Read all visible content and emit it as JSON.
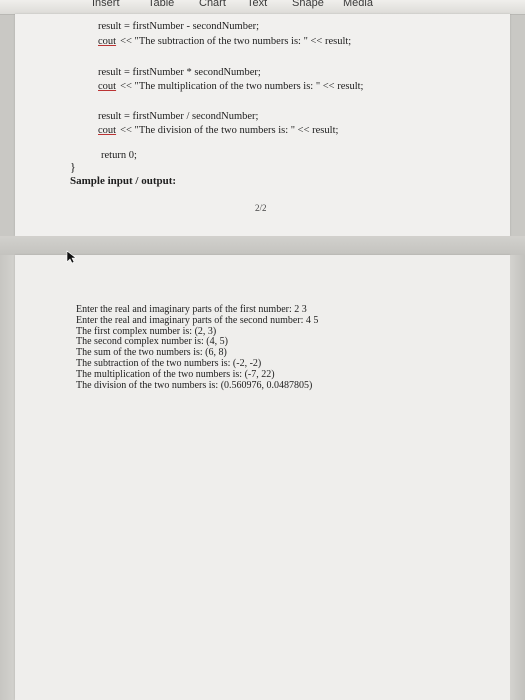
{
  "toolbar": {
    "items": [
      "Insert",
      "Table",
      "Chart",
      "Text",
      "Shape",
      "Media"
    ]
  },
  "code": {
    "lines": [
      "result = firstNumber - secondNumber;",
      "<< \"The subtraction of the two numbers is: \" << result;",
      "result = firstNumber * secondNumber;",
      "<< \"The multiplication of the two numbers is: \" << result;",
      "result = firstNumber / secondNumber;",
      "<< \"The division of the two numbers is: \" << result;",
      "return 0;"
    ],
    "cout": "cout",
    "closing_brace": "}"
  },
  "sample_heading": "Sample input / output:",
  "page_number": "2/2",
  "output_lines": [
    "Enter the real and imaginary parts of the first number: 2 3",
    "Enter the real and imaginary parts of the second number: 4 5",
    "The first complex number is: (2, 3)",
    "The second complex number is: (4, 5)",
    "The sum of the two numbers is: (6, 8)",
    "The subtraction of the two numbers is: (-2, -2)",
    "The multiplication of the two numbers is: (-7, 22)",
    "The division of the two numbers is: (0.560976, 0.0487805)"
  ]
}
